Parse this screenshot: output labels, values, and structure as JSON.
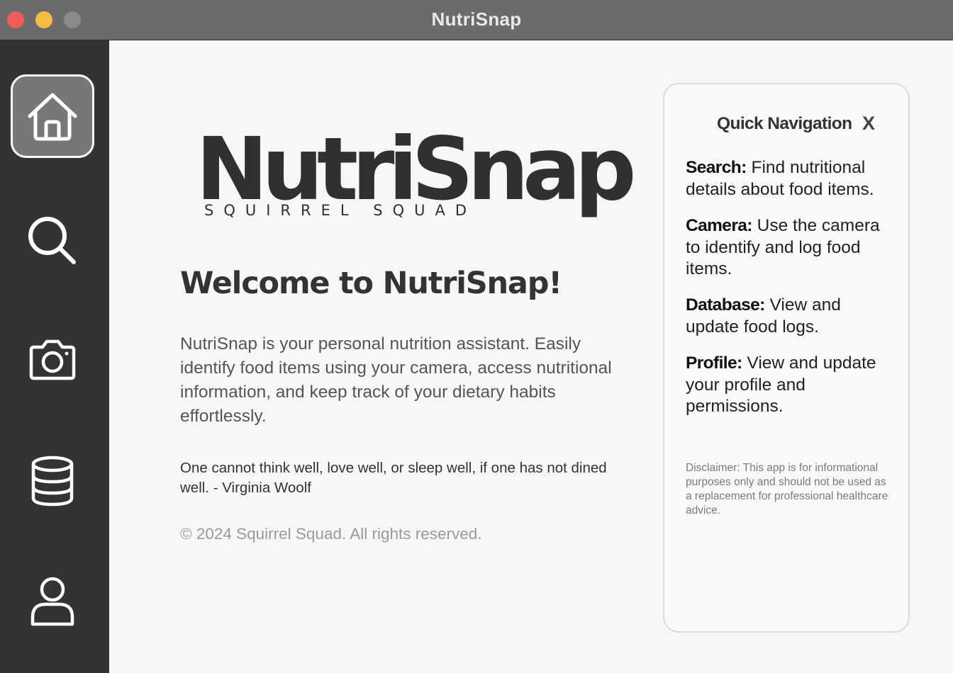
{
  "window": {
    "title": "NutriSnap"
  },
  "sidebar": {
    "items": [
      {
        "name": "home",
        "icon": "home-icon",
        "active": true
      },
      {
        "name": "search",
        "icon": "search-icon",
        "active": false
      },
      {
        "name": "camera",
        "icon": "camera-icon",
        "active": false
      },
      {
        "name": "database",
        "icon": "database-icon",
        "active": false
      },
      {
        "name": "profile",
        "icon": "profile-icon",
        "active": false
      }
    ]
  },
  "main": {
    "logo": {
      "word": "NutriSnap",
      "tagline": "SQUIRREL SQUAD"
    },
    "welcome": "Welcome to NutriSnap!",
    "intro": "NutriSnap is your personal nutrition assistant. Easily identify food items using your camera, access nutritional information, and keep track of your dietary habits effortlessly.",
    "quote": "One cannot think well, love well, or sleep well, if one has not dined well. - Virginia Woolf",
    "footer": "© 2024 Squirrel Squad. All rights reserved."
  },
  "quick_nav": {
    "title": "Quick Navigation",
    "close_label": "X",
    "items": [
      {
        "label": "Search:",
        "text": " Find nutritional details about food items."
      },
      {
        "label": "Camera:",
        "text": " Use the camera to identify and log food items."
      },
      {
        "label": "Database:",
        "text": " View and update food logs."
      },
      {
        "label": "Profile:",
        "text": " View and update your profile and permissions."
      }
    ],
    "disclaimer": "Disclaimer: This app is for informational purposes only and should not be used as a replacement for professional healthcare advice."
  },
  "colors": {
    "sidebar_bg": "#333333",
    "active_button": "#777777",
    "title_bar": "#6b6b6b",
    "content_bg": "#f7f7f7",
    "traffic_red": "#ee5e56",
    "traffic_yellow": "#f4bd41"
  }
}
